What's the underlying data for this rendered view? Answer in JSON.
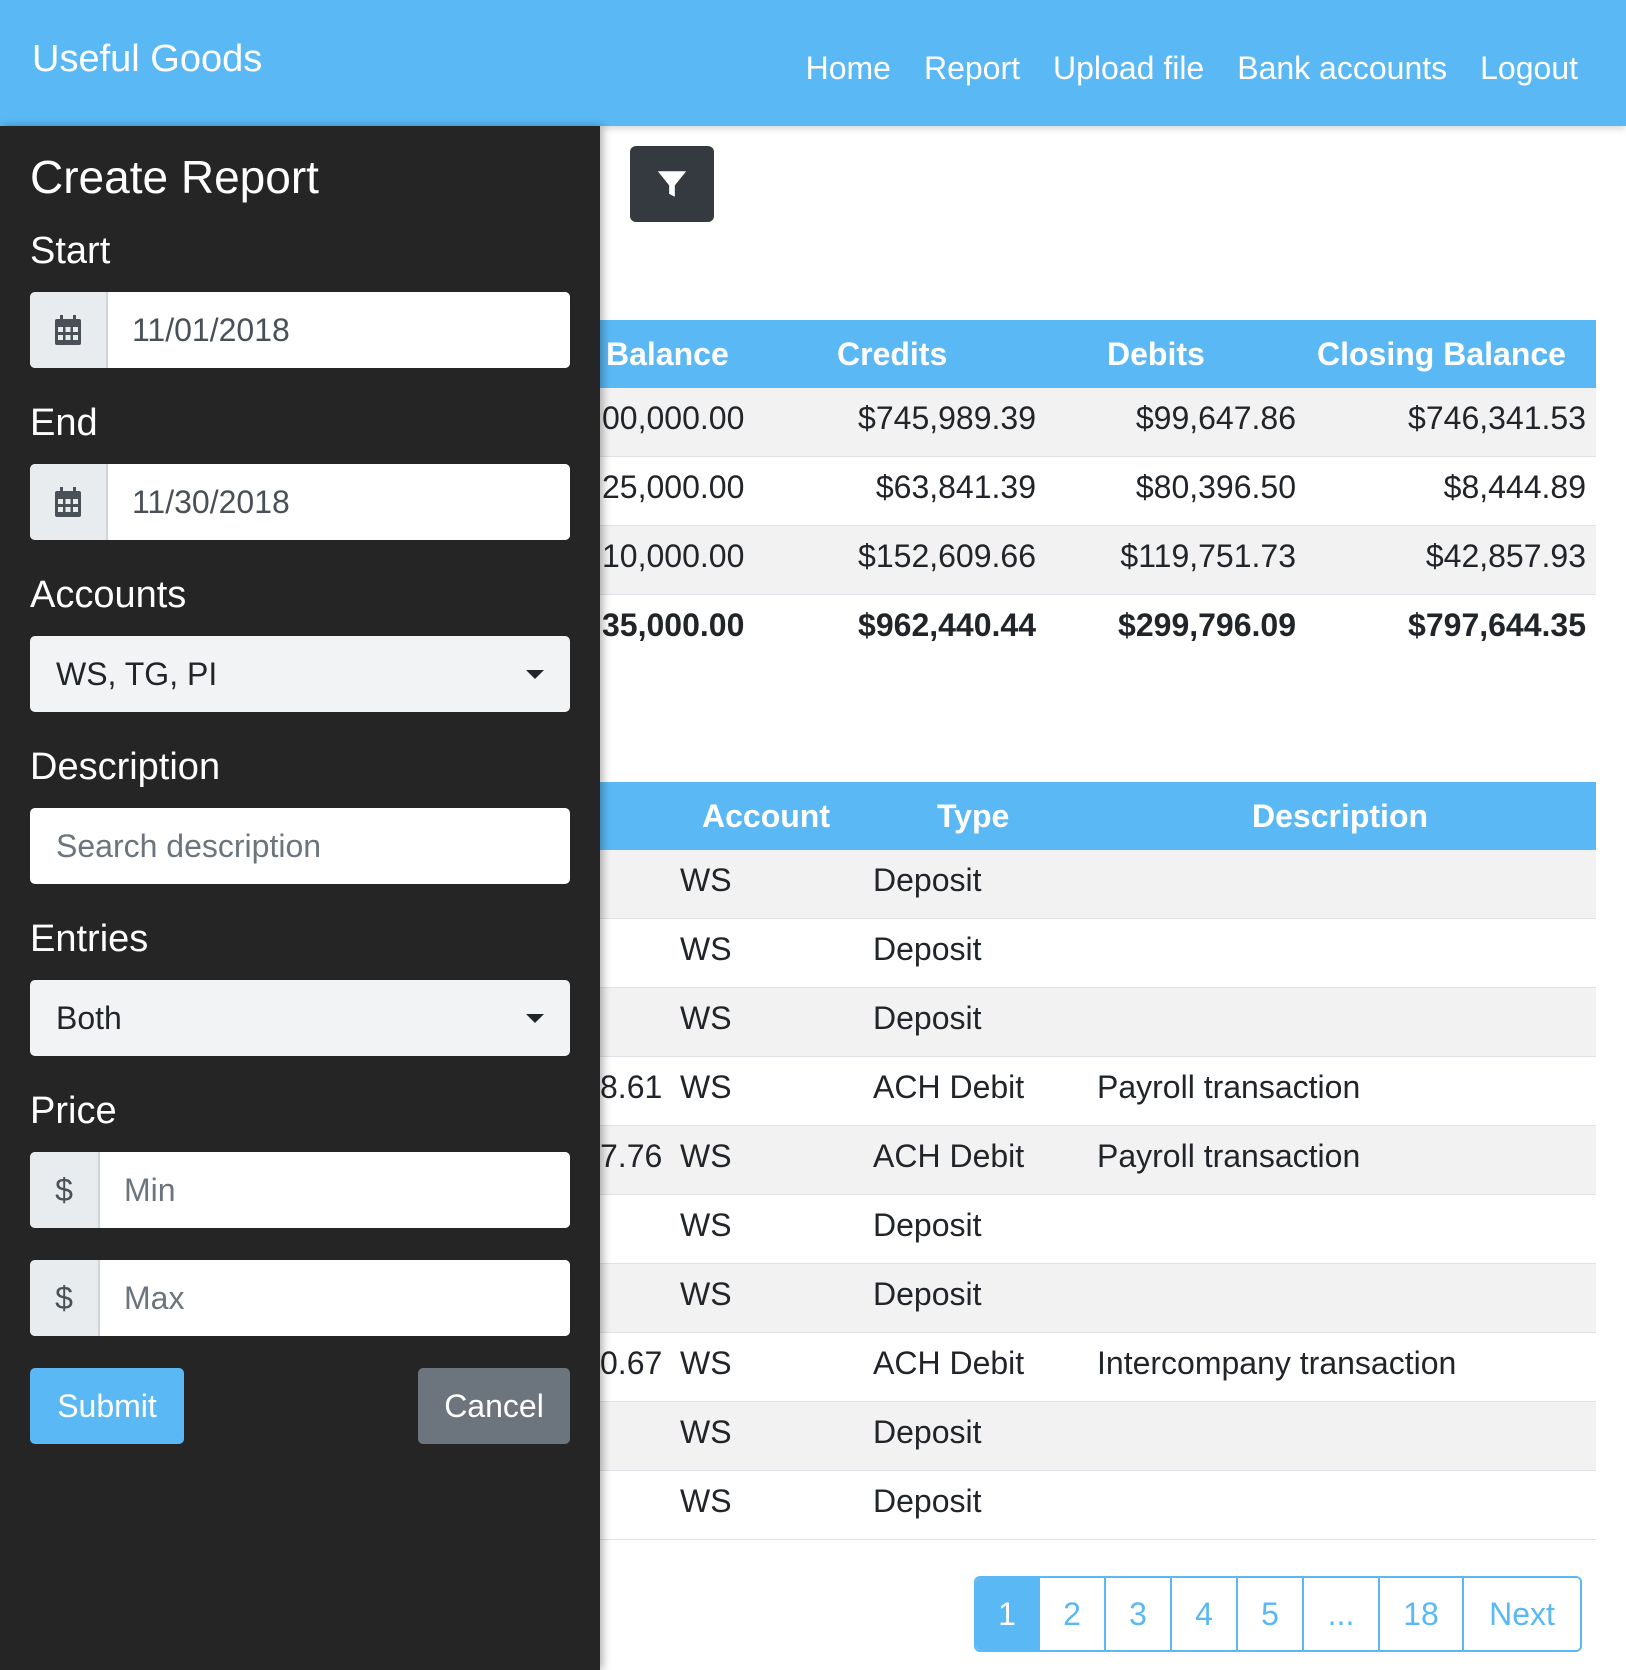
{
  "navbar": {
    "brand": "Useful Goods",
    "links": [
      "Home",
      "Report",
      "Upload file",
      "Bank accounts",
      "Logout"
    ]
  },
  "sidebar": {
    "title": "Create Report",
    "start": {
      "label": "Start",
      "value": "11/01/2018",
      "icon": "calendar-icon"
    },
    "end": {
      "label": "End",
      "value": "11/30/2018",
      "icon": "calendar-icon"
    },
    "accounts": {
      "label": "Accounts",
      "value": "WS, TG, PI"
    },
    "description": {
      "label": "Description",
      "placeholder": "Search description"
    },
    "entries": {
      "label": "Entries",
      "value": "Both"
    },
    "price": {
      "label": "Price",
      "currency": "$",
      "min_placeholder": "Min",
      "max_placeholder": "Max"
    },
    "submit_label": "Submit",
    "cancel_label": "Cancel"
  },
  "filter_button": {
    "icon": "filter-icon"
  },
  "summary_table": {
    "headers": [
      "Balance",
      "Credits",
      "Debits",
      "Closing Balance"
    ],
    "rows": [
      [
        "00,000.00",
        "$745,989.39",
        "$99,647.86",
        "$746,341.53"
      ],
      [
        "25,000.00",
        "$63,841.39",
        "$80,396.50",
        "$8,444.89"
      ],
      [
        "10,000.00",
        "$152,609.66",
        "$119,751.73",
        "$42,857.93"
      ]
    ],
    "totals": [
      "35,000.00",
      "$962,440.44",
      "$299,796.09",
      "$797,644.35"
    ]
  },
  "transactions_table": {
    "headers": [
      "Account",
      "Type",
      "Description"
    ],
    "rows": [
      {
        "amount": "",
        "account": "WS",
        "type": "Deposit",
        "description": ""
      },
      {
        "amount": "",
        "account": "WS",
        "type": "Deposit",
        "description": ""
      },
      {
        "amount": "",
        "account": "WS",
        "type": "Deposit",
        "description": ""
      },
      {
        "amount": "8.61",
        "account": "WS",
        "type": "ACH Debit",
        "description": "Payroll transaction"
      },
      {
        "amount": "7.76",
        "account": "WS",
        "type": "ACH Debit",
        "description": "Payroll transaction"
      },
      {
        "amount": "",
        "account": "WS",
        "type": "Deposit",
        "description": ""
      },
      {
        "amount": "",
        "account": "WS",
        "type": "Deposit",
        "description": ""
      },
      {
        "amount": "0.67",
        "account": "WS",
        "type": "ACH Debit",
        "description": "Intercompany transaction"
      },
      {
        "amount": "",
        "account": "WS",
        "type": "Deposit",
        "description": ""
      },
      {
        "amount": "",
        "account": "WS",
        "type": "Deposit",
        "description": ""
      }
    ]
  },
  "pagination": {
    "pages": [
      "1",
      "2",
      "3",
      "4",
      "5",
      "...",
      "18"
    ],
    "active": "1",
    "next_label": "Next"
  },
  "colors": {
    "accent": "#5ab9f5",
    "sidebar_bg": "#252525",
    "cancel": "#6c757d",
    "filter_button": "#343a40"
  }
}
